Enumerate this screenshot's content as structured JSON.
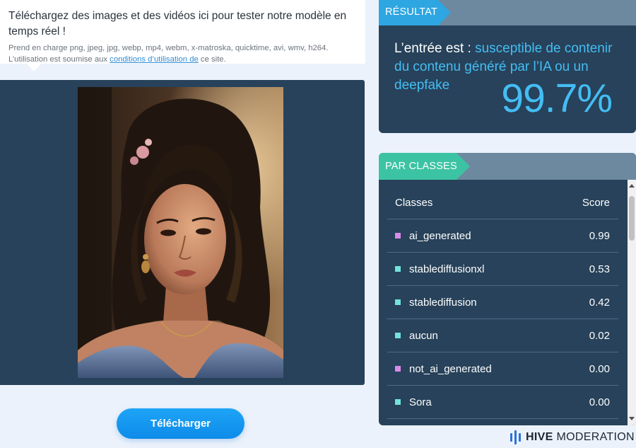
{
  "upload": {
    "heading": "Téléchargez des images et des vidéos ici pour tester notre modèle en temps réel !",
    "formats": "Prend en charge png, jpeg, jpg, webp, mp4, webm, x-matroska, quicktime, avi, wmv, h264.",
    "terms_prefix": "L’utilisation est soumise aux ",
    "terms_link": "conditions d’utilisation de",
    "terms_suffix": " ce site.",
    "button_label": "Télécharger"
  },
  "result": {
    "tag": "RÉSULTAT",
    "prefix": "L’entrée est : ",
    "verdict": "susceptible de contenir du contenu généré par l’IA ou un deepfake",
    "score": "99.7%"
  },
  "classes": {
    "tag": "PAR CLASSES",
    "col_class": "Classes",
    "col_score": "Score",
    "rows": [
      {
        "name": "ai_generated",
        "score": "0.99",
        "color": "#d98be9"
      },
      {
        "name": "stablediffusionxl",
        "score": "0.53",
        "color": "#72e3da"
      },
      {
        "name": "stablediffusion",
        "score": "0.42",
        "color": "#72e3da"
      },
      {
        "name": "aucun",
        "score": "0.02",
        "color": "#72e3da"
      },
      {
        "name": "not_ai_generated",
        "score": "0.00",
        "color": "#d98be9"
      },
      {
        "name": "Sora",
        "score": "0.00",
        "color": "#72e3da"
      }
    ]
  },
  "brand": {
    "name_bold": "HIVE",
    "name_rest": "MODERATION"
  }
}
